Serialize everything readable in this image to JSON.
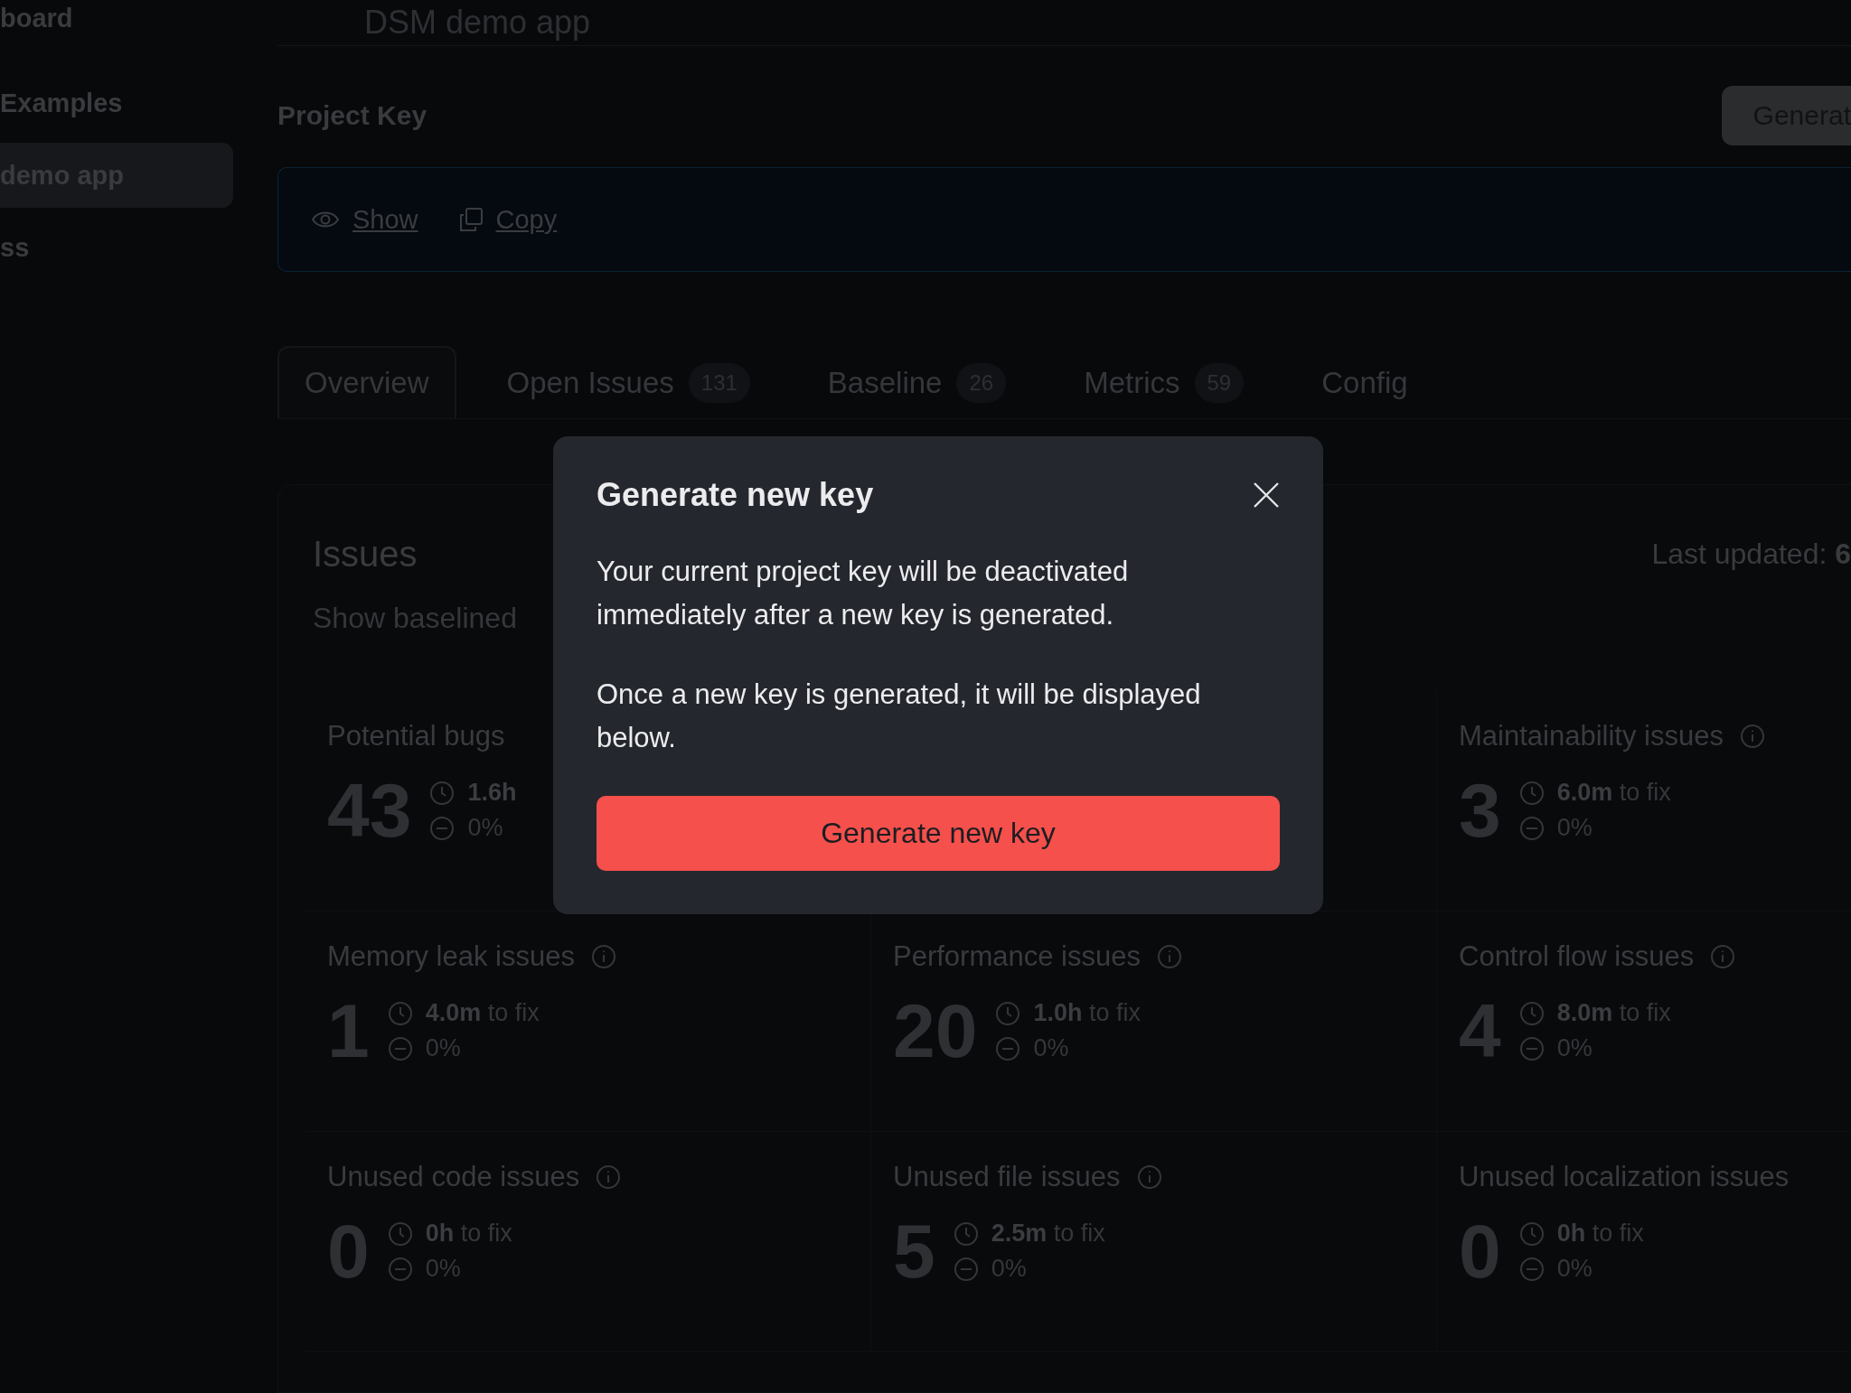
{
  "sidebar": {
    "items": [
      {
        "label": "board",
        "selected": false
      },
      {
        "label": "Examples",
        "selected": false
      },
      {
        "label": "demo app",
        "selected": true
      },
      {
        "label": "ss",
        "selected": false
      }
    ]
  },
  "header": {
    "title": "DSM demo app"
  },
  "project_key": {
    "heading": "Project Key",
    "generate_button": "Generat",
    "actions": [
      {
        "kind": "show",
        "label": "Show"
      },
      {
        "kind": "copy",
        "label": "Copy"
      }
    ]
  },
  "tabs": [
    {
      "label": "Overview",
      "selected": true
    },
    {
      "label": "Open Issues",
      "count": "131",
      "selected": false
    },
    {
      "label": "Baseline",
      "count": "26",
      "selected": false
    },
    {
      "label": "Metrics",
      "count": "59",
      "selected": false
    },
    {
      "label": "Config",
      "selected": false
    }
  ],
  "issues": {
    "title": "Issues",
    "toggle_label": "Show baselined",
    "last_updated_label": "Last updated:",
    "last_updated_value": "6",
    "cards": [
      {
        "kind": "card",
        "title": "Potential bugs",
        "info": false,
        "count": "43",
        "time": "1.6h",
        "change": "0%"
      },
      {
        "kind": "covered"
      },
      {
        "kind": "card",
        "title": "Maintainability issues",
        "info": true,
        "count": "3",
        "time": "6.0m",
        "time_suffix": "to fix",
        "change": "0%"
      },
      {
        "kind": "card",
        "title": "Memory leak issues",
        "info": true,
        "count": "1",
        "time": "4.0m",
        "time_suffix": "to fix",
        "change": "0%"
      },
      {
        "kind": "card",
        "title": "Performance issues",
        "info": true,
        "count": "20",
        "time": "1.0h",
        "time_suffix": "to fix",
        "change": "0%"
      },
      {
        "kind": "card",
        "title": "Control flow issues",
        "info": true,
        "count": "4",
        "time": "8.0m",
        "time_suffix": "to fix",
        "change": "0%"
      },
      {
        "kind": "card",
        "title": "Unused code issues",
        "info": true,
        "count": "0",
        "time": "0h",
        "time_suffix": "to fix",
        "change": "0%"
      },
      {
        "kind": "card",
        "title": "Unused file issues",
        "info": true,
        "count": "5",
        "time": "2.5m",
        "time_suffix": "to fix",
        "change": "0%"
      },
      {
        "kind": "card",
        "title": "Unused localization issues",
        "info": false,
        "count": "0",
        "time": "0h",
        "time_suffix": "to fix",
        "change": "0%"
      }
    ]
  },
  "dialog": {
    "title": "Generate new key",
    "paragraphs": [
      "Your current project key will be deactivated immediately after a new key is generated.",
      "Once a new key is generated, it will be displayed below."
    ],
    "button": "Generate new key"
  }
}
